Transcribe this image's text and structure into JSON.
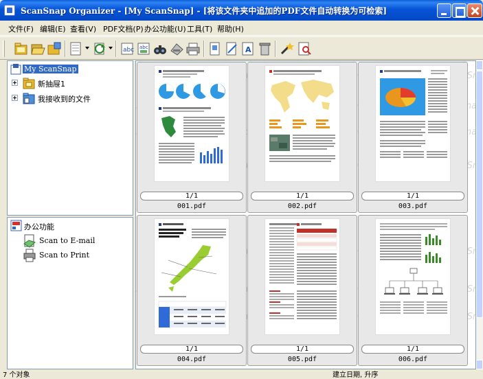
{
  "window": {
    "title": "ScanSnap Organizer - [My ScanSnap] - [将该文件夹中追加的PDF文件自动转换为可检索]"
  },
  "menu": [
    "文件(F)",
    "编辑(E)",
    "查看(V)",
    "PDF文档(P)",
    "办公功能(U)",
    "工具(T)",
    "帮助(H)"
  ],
  "toolbar": {
    "icons": [
      "folder-icon",
      "folder-open-icon",
      "folder-add-icon",
      "view-icon",
      "rotate-icon",
      "text-icon",
      "text-image-icon",
      "binoculars-icon",
      "scan-icon",
      "print-icon",
      "page-icon",
      "edit-page-icon",
      "ocr-icon",
      "trash-icon",
      "wand-icon",
      "search-page-icon"
    ]
  },
  "tree": {
    "root": "My ScanSnap",
    "items": [
      "新抽屉1",
      "我接收到的文件"
    ]
  },
  "office": {
    "header": "办公功能",
    "items": [
      "Scan to E-mail",
      "Scan to Print"
    ]
  },
  "files": [
    {
      "page": "1/1",
      "name": "001.pdf"
    },
    {
      "page": "1/1",
      "name": "002.pdf"
    },
    {
      "page": "1/1",
      "name": "003.pdf"
    },
    {
      "page": "1/1",
      "name": "004.pdf"
    },
    {
      "page": "1/1",
      "name": "005.pdf"
    },
    {
      "page": "1/1",
      "name": "006.pdf"
    }
  ],
  "watermark": "ScanSnap",
  "status": {
    "count": "7 个对象",
    "sort": "建立日期, 升序"
  },
  "colors": {
    "titlebar": "#0654d6",
    "selection": "#316ac5",
    "chart_blue": "#2f9ae3",
    "map_yellow": "#f3dd8a",
    "map_green": "#9acd32",
    "bar_orange": "#e8961e",
    "pie_red": "#e23c2c"
  }
}
